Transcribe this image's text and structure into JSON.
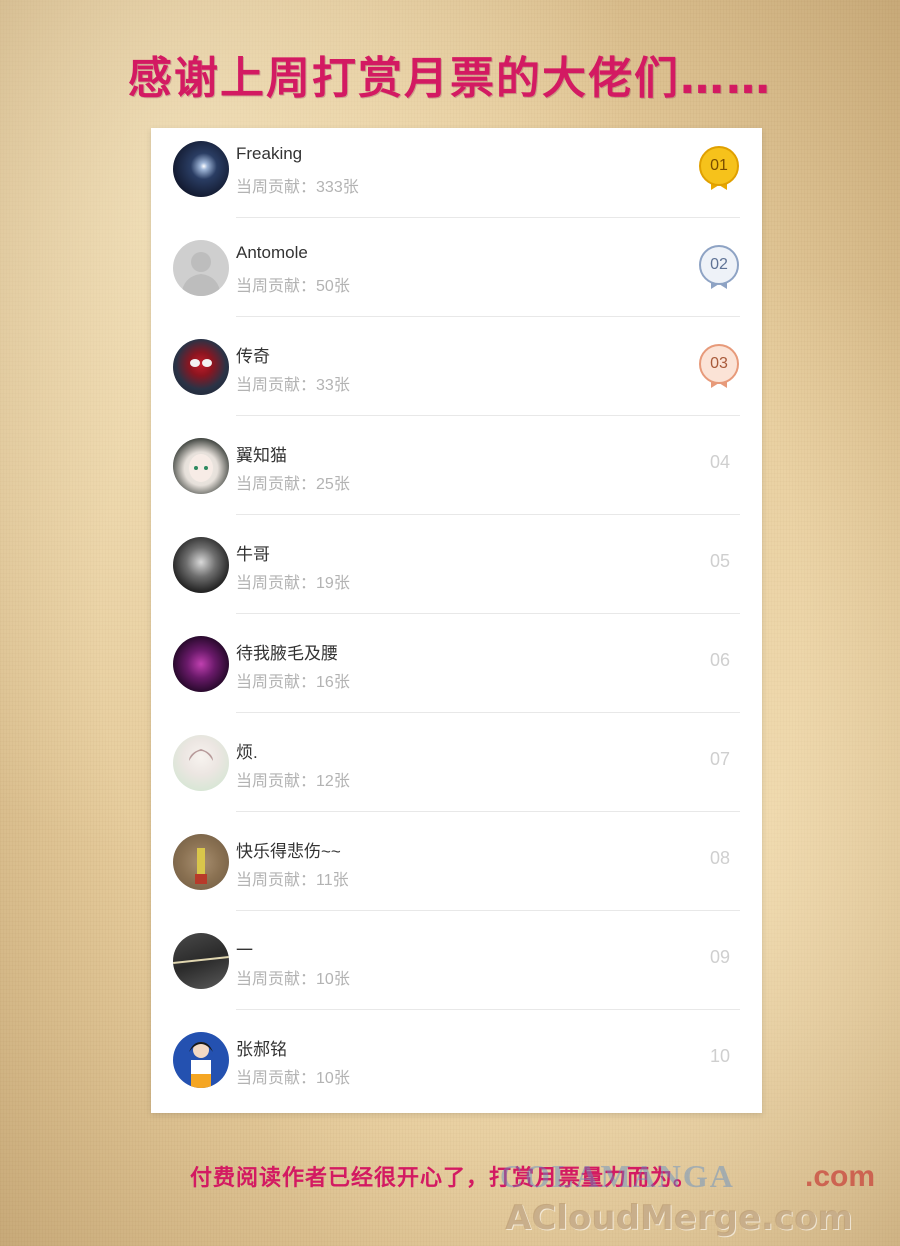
{
  "headline": "感谢上周打赏月票的大佬们……",
  "contrib_prefix": "当周贡献：",
  "supporters": [
    {
      "name": "Freaking",
      "count": "333张",
      "rank": "01",
      "medal": "gold"
    },
    {
      "name": "Antomole",
      "count": "50张",
      "rank": "02",
      "medal": "silver"
    },
    {
      "name": "传奇",
      "count": "33张",
      "rank": "03",
      "medal": "bronze"
    },
    {
      "name": "翼知猫",
      "count": "25张",
      "rank": "04",
      "medal": "none"
    },
    {
      "name": "牛哥",
      "count": "19张",
      "rank": "05",
      "medal": "none"
    },
    {
      "name": "待我腋毛及腰",
      "count": "16张",
      "rank": "06",
      "medal": "none"
    },
    {
      "name": "烦.",
      "count": "12张",
      "rank": "07",
      "medal": "none"
    },
    {
      "name": "快乐得悲伤~~",
      "count": "11张",
      "rank": "08",
      "medal": "none"
    },
    {
      "name": "一",
      "count": "10张",
      "rank": "09",
      "medal": "none"
    },
    {
      "name": "张郝铭",
      "count": "10张",
      "rank": "10",
      "medal": "none"
    }
  ],
  "footer": "付费阅读作者已经很开心了，打赏月票量力而为。",
  "watermark_top": "COLAMANGA",
  "watermark_top_suffix": ".com",
  "watermark_bottom": "ACloudMerge.com",
  "colors": {
    "accent": "#d31a62",
    "gold": "#e9a900",
    "silver": "#8ea3c4",
    "bronze": "#e79a7a"
  }
}
